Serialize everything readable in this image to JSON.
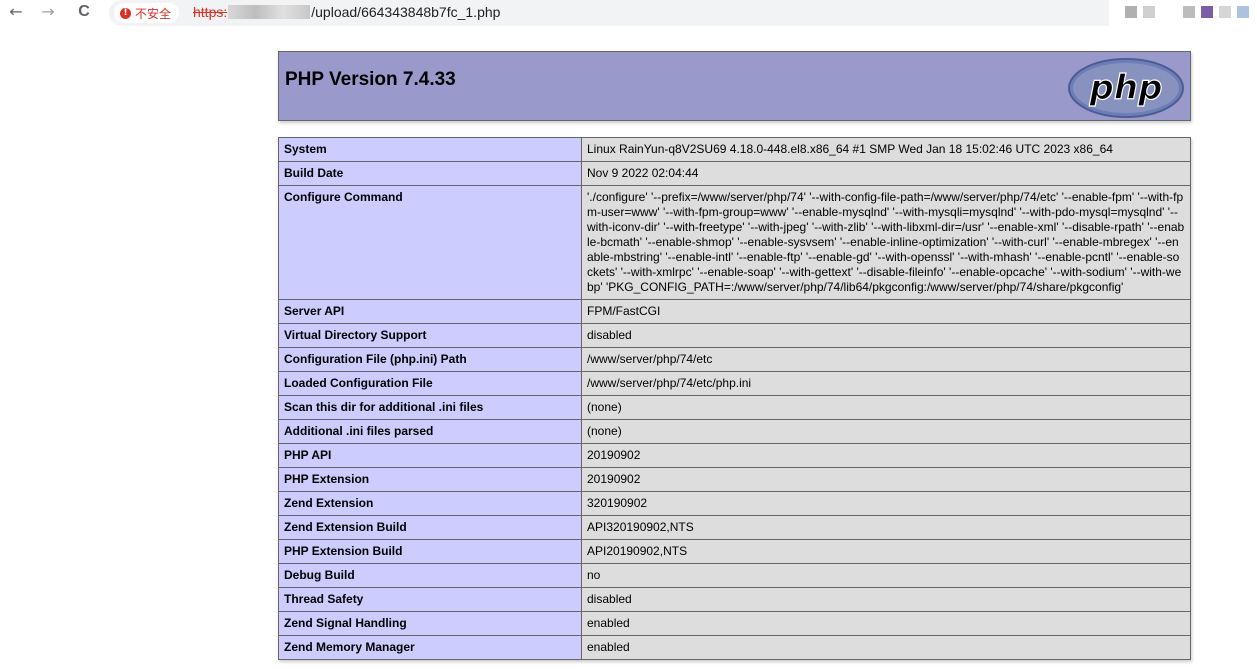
{
  "browser": {
    "insecure_label": "不安全",
    "url_scheme": "https:",
    "url_path": "/upload/664343848b7fc_1.php",
    "back_glyph": "←",
    "forward_glyph": "→",
    "reload_glyph": "C"
  },
  "phpinfo": {
    "title": "PHP Version 7.4.33",
    "logo_text": "php",
    "rows": [
      {
        "key": "System",
        "value": "Linux RainYun-q8V2SU69 4.18.0-448.el8.x86_64 #1 SMP Wed Jan 18 15:02:46 UTC 2023 x86_64"
      },
      {
        "key": "Build Date",
        "value": "Nov 9 2022 02:04:44"
      },
      {
        "key": "Configure Command",
        "value": "'./configure' '--prefix=/www/server/php/74' '--with-config-file-path=/www/server/php/74/etc' '--enable-fpm' '--with-fpm-user=www' '--with-fpm-group=www' '--enable-mysqlnd' '--with-mysqli=mysqlnd' '--with-pdo-mysql=mysqlnd' '--with-iconv-dir' '--with-freetype' '--with-jpeg' '--with-zlib' '--with-libxml-dir=/usr' '--enable-xml' '--disable-rpath' '--enable-bcmath' '--enable-shmop' '--enable-sysvsem' '--enable-inline-optimization' '--with-curl' '--enable-mbregex' '--enable-mbstring' '--enable-intl' '--enable-ftp' '--enable-gd' '--with-openssl' '--with-mhash' '--enable-pcntl' '--enable-sockets' '--with-xmlrpc' '--enable-soap' '--with-gettext' '--disable-fileinfo' '--enable-opcache' '--with-sodium' '--with-webp' 'PKG_CONFIG_PATH=:/www/server/php/74/lib64/pkgconfig:/www/server/php/74/share/pkgconfig'"
      },
      {
        "key": "Server API",
        "value": "FPM/FastCGI"
      },
      {
        "key": "Virtual Directory Support",
        "value": "disabled"
      },
      {
        "key": "Configuration File (php.ini) Path",
        "value": "/www/server/php/74/etc"
      },
      {
        "key": "Loaded Configuration File",
        "value": "/www/server/php/74/etc/php.ini"
      },
      {
        "key": "Scan this dir for additional .ini files",
        "value": "(none)"
      },
      {
        "key": "Additional .ini files parsed",
        "value": "(none)"
      },
      {
        "key": "PHP API",
        "value": "20190902"
      },
      {
        "key": "PHP Extension",
        "value": "20190902"
      },
      {
        "key": "Zend Extension",
        "value": "320190902"
      },
      {
        "key": "Zend Extension Build",
        "value": "API320190902,NTS"
      },
      {
        "key": "PHP Extension Build",
        "value": "API20190902,NTS"
      },
      {
        "key": "Debug Build",
        "value": "no"
      },
      {
        "key": "Thread Safety",
        "value": "disabled"
      },
      {
        "key": "Zend Signal Handling",
        "value": "enabled"
      },
      {
        "key": "Zend Memory Manager",
        "value": "enabled"
      }
    ]
  },
  "colors": {
    "header_bg": "#9999cc",
    "key_cell_bg": "#ccccff",
    "value_cell_bg": "#dddddd",
    "insecure_red": "#d93025"
  }
}
